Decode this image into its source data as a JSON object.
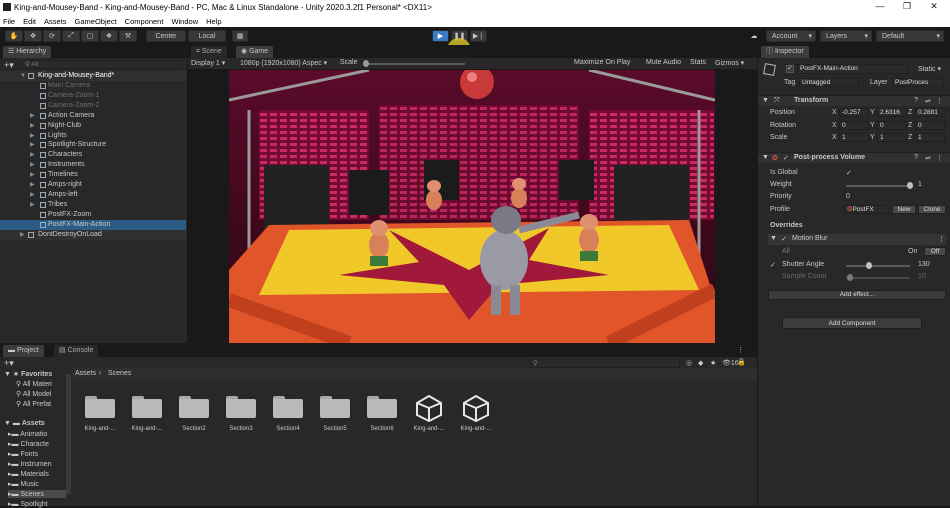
{
  "window": {
    "title": "King-and-Mousey-Band - King-and-Mousey-Band - PC, Mac & Linux Standalone - Unity 2020.3.2f1 Personal* <DX11>",
    "controls": [
      "—",
      "❐",
      "✕"
    ]
  },
  "menu": [
    "File",
    "Edit",
    "Assets",
    "GameObject",
    "Component",
    "Window",
    "Help"
  ],
  "toolbar": {
    "pivot": "Center",
    "space": "Local",
    "account": "Account",
    "layers": "Layers",
    "layout": "Default"
  },
  "hierarchy": {
    "tab": "Hierarchy",
    "search_placeholder": "All",
    "scene": "King-and-Mousey-Band*",
    "items": [
      {
        "label": "Main Camera",
        "dim": true
      },
      {
        "label": "Camera-Zoom-1",
        "dim": true
      },
      {
        "label": "Camera-Zoom-2",
        "dim": true
      },
      {
        "label": "Action Camera",
        "dim": false
      },
      {
        "label": "Night-Club",
        "dim": false
      },
      {
        "label": "Lights",
        "dim": false
      },
      {
        "label": "Spotlight-Structure",
        "dim": false
      },
      {
        "label": "Characters",
        "dim": false
      },
      {
        "label": "Instruments",
        "dim": false
      },
      {
        "label": "Timelines",
        "dim": false
      },
      {
        "label": "Amps-right",
        "dim": false
      },
      {
        "label": "Amps-left",
        "dim": false
      },
      {
        "label": "Tribes",
        "dim": false
      },
      {
        "label": "PostFX-Zoom",
        "dim": false
      },
      {
        "label": "PostFX-Main-Action",
        "dim": false
      }
    ],
    "dont_destroy": "DontDestroyOnLoad"
  },
  "game_view": {
    "tabs": [
      "Scene",
      "Game"
    ],
    "display": "Display 1",
    "resolution": "1080p (1920x1080) Aspec",
    "scale_label": "Scale",
    "options": [
      "Maximize On Play",
      "Mute Audio",
      "Stats",
      "Gizmos"
    ]
  },
  "inspector": {
    "tab": "Inspector",
    "object_name": "PostFX-Main-Action",
    "static_label": "Static",
    "tag_label": "Tag",
    "tag_value": "Untagged",
    "layer_label": "Layer",
    "layer_value": "PostProces",
    "transform": {
      "title": "Transform",
      "rows": [
        {
          "label": "Position",
          "x": "-0.257",
          "y": "2.6316",
          "z": "0.2881"
        },
        {
          "label": "Rotation",
          "x": "0",
          "y": "0",
          "z": "0"
        },
        {
          "label": "Scale",
          "x": "1",
          "y": "1",
          "z": "1"
        }
      ]
    },
    "volume": {
      "title": "Post-process Volume",
      "is_global_label": "Is Global",
      "weight_label": "Weight",
      "weight_value": "1",
      "weight_fraction": 1.0,
      "priority_label": "Priority",
      "priority_value": "0",
      "profile_label": "Profile",
      "profile_value": "PostFX",
      "new_label": "New",
      "clone_label": "Clone"
    },
    "overrides": {
      "title": "Overrides",
      "effect": "Motion Blur",
      "all_label": "All",
      "on_label": "On",
      "off_label": "Off",
      "shutter_label": "Shutter Angle",
      "shutter_value": "130",
      "shutter_fraction": 0.36,
      "sample_label": "Sample Count",
      "sample_value": "10",
      "sample_fraction": 0.06,
      "add_effect": "Add effect..."
    },
    "add_component": "Add Component"
  },
  "project": {
    "tabs": [
      "Project",
      "Console"
    ],
    "favorites_label": "Favorites",
    "favorites": [
      "All Materi",
      "All Model",
      "All Prefat"
    ],
    "assets_label": "Assets",
    "tree": [
      "Animatio",
      "Characte",
      "Fonts",
      "Instrumen",
      "Materials",
      "Music",
      "Scenes",
      "Spotlight"
    ],
    "breadcrumb": [
      "Assets",
      "Scenes"
    ],
    "count": "16",
    "items": [
      {
        "label": "King-and-...",
        "type": "folder"
      },
      {
        "label": "King-and-...",
        "type": "folder"
      },
      {
        "label": "Section2",
        "type": "folder"
      },
      {
        "label": "Section3",
        "type": "folder"
      },
      {
        "label": "Section4",
        "type": "folder"
      },
      {
        "label": "Section5",
        "type": "folder"
      },
      {
        "label": "Section6",
        "type": "folder"
      },
      {
        "label": "King-and-...",
        "type": "unity-scene"
      },
      {
        "label": "King-and-...",
        "type": "unity-scene"
      }
    ]
  },
  "colors": {
    "selection": "#2c5d87",
    "play_active": "#3a7ac6",
    "panel": "#282828"
  }
}
